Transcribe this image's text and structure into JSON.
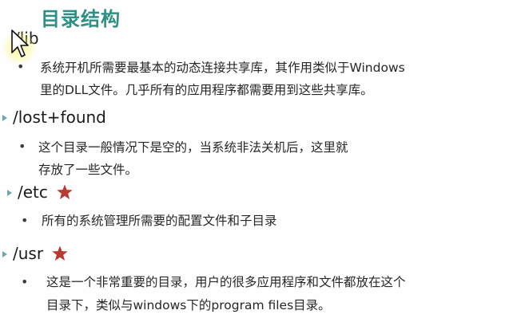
{
  "title": "目录结构",
  "entries": [
    {
      "name": "/lib",
      "starred": false,
      "lines": [
        "系统开机所需要最基本的动态连接共享库，其作用类似于Windows",
        "里的DLL文件。几乎所有的应用程序都需要用到这些共享库。"
      ]
    },
    {
      "name": "/lost+found",
      "starred": false,
      "lines": [
        "这个目录一般情况下是空的，当系统非法关机后，这里就",
        "存放了一些文件。"
      ]
    },
    {
      "name": "/etc",
      "starred": true,
      "lines": [
        "所有的系统管理所需要的配置文件和子目录"
      ]
    },
    {
      "name": "/usr",
      "starred": true,
      "lines": [
        "这是一个非常重要的目录，用户的很多应用程序和文件都放在这个",
        "目录下，类似与windows下的program files目录。"
      ]
    }
  ],
  "bullet_char": "•",
  "colors": {
    "title": "#2f8f83",
    "star": "#b8392f",
    "arrow": "#6aa8b0",
    "text": "#262626"
  },
  "icons": {
    "star": "star-icon",
    "arrow": "arrow-bullet-icon",
    "cursor": "mouse-cursor-icon"
  }
}
